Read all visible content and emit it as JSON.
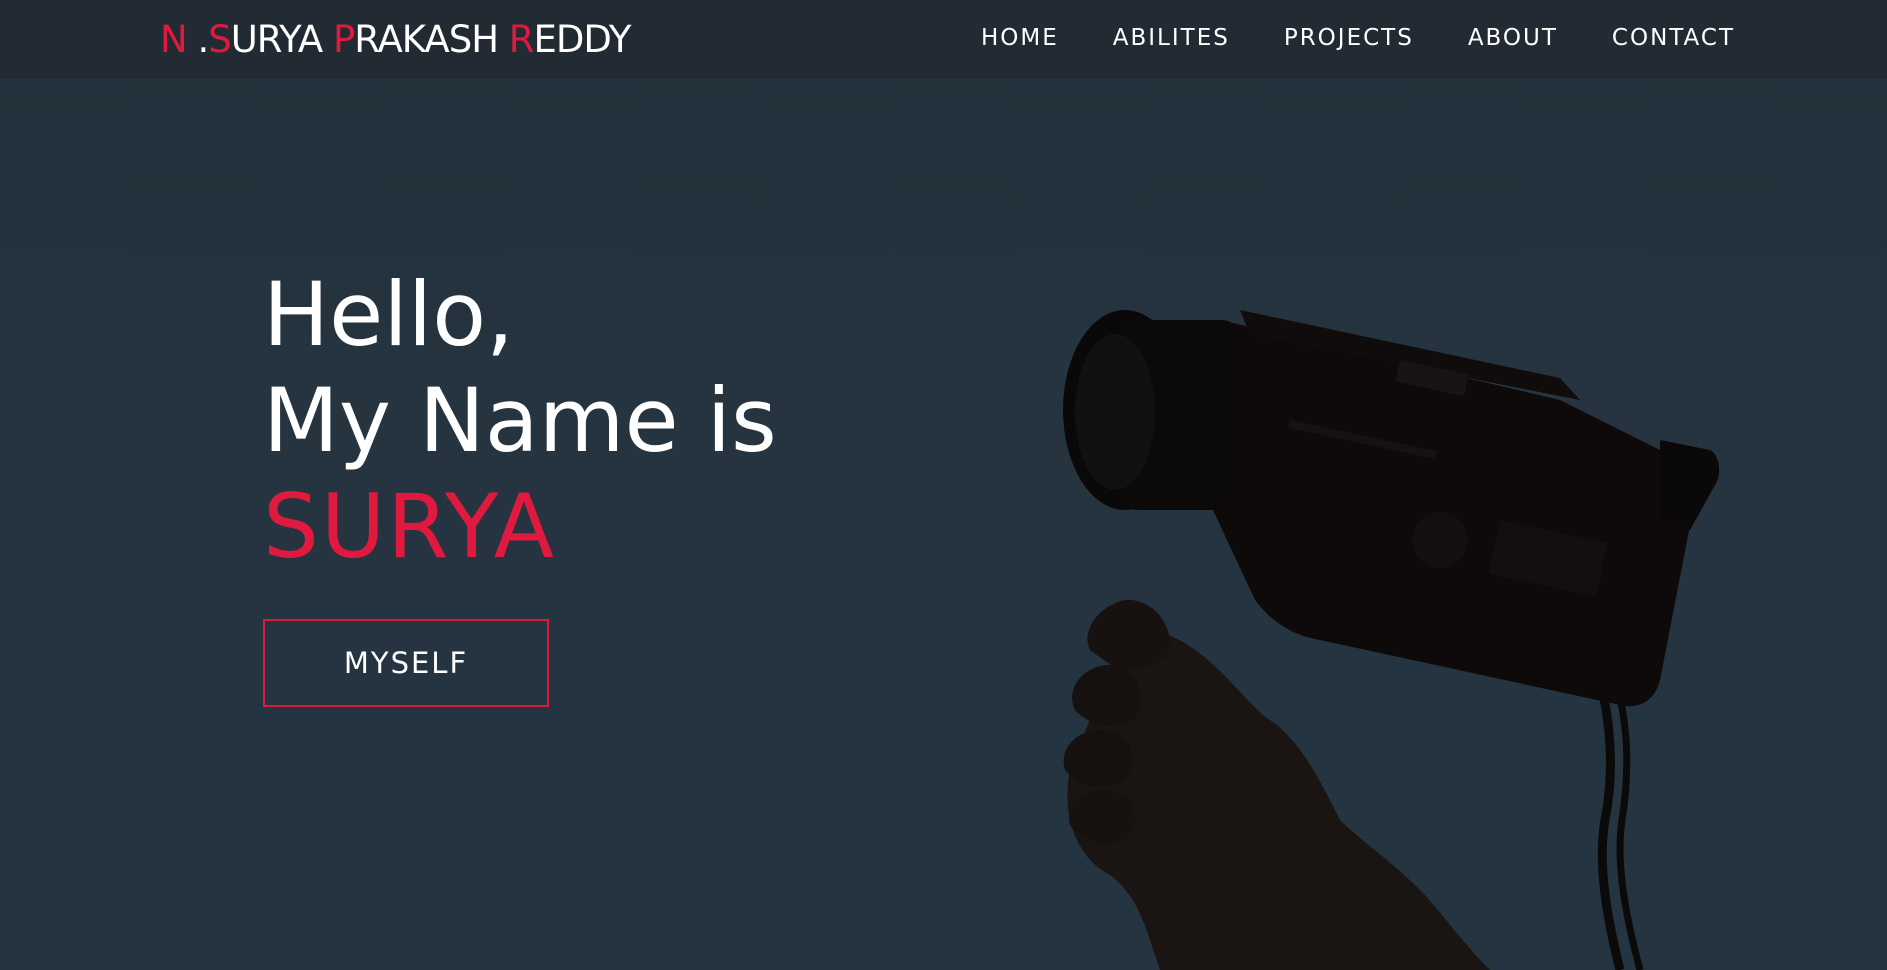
{
  "brand": {
    "parts": [
      {
        "text": "N",
        "accent": true
      },
      {
        "text": " .",
        "accent": false
      },
      {
        "text": "S",
        "accent": true
      },
      {
        "text": "URYA ",
        "accent": false
      },
      {
        "text": "P",
        "accent": true
      },
      {
        "text": "RAKASH ",
        "accent": false
      },
      {
        "text": "R",
        "accent": true
      },
      {
        "text": "EDDY",
        "accent": false
      }
    ]
  },
  "nav": {
    "items": [
      {
        "label": "HOME"
      },
      {
        "label": "ABILITES"
      },
      {
        "label": "PROJECTS"
      },
      {
        "label": "ABOUT"
      },
      {
        "label": "CONTACT"
      }
    ]
  },
  "hero": {
    "greeting": "Hello,",
    "intro": "My Name is",
    "name": "SURYA",
    "button_label": "MYSELF"
  },
  "colors": {
    "accent": "#e0193f",
    "navbar_bg": "#222b33",
    "page_bg": "#25333d",
    "text": "#ffffff"
  }
}
